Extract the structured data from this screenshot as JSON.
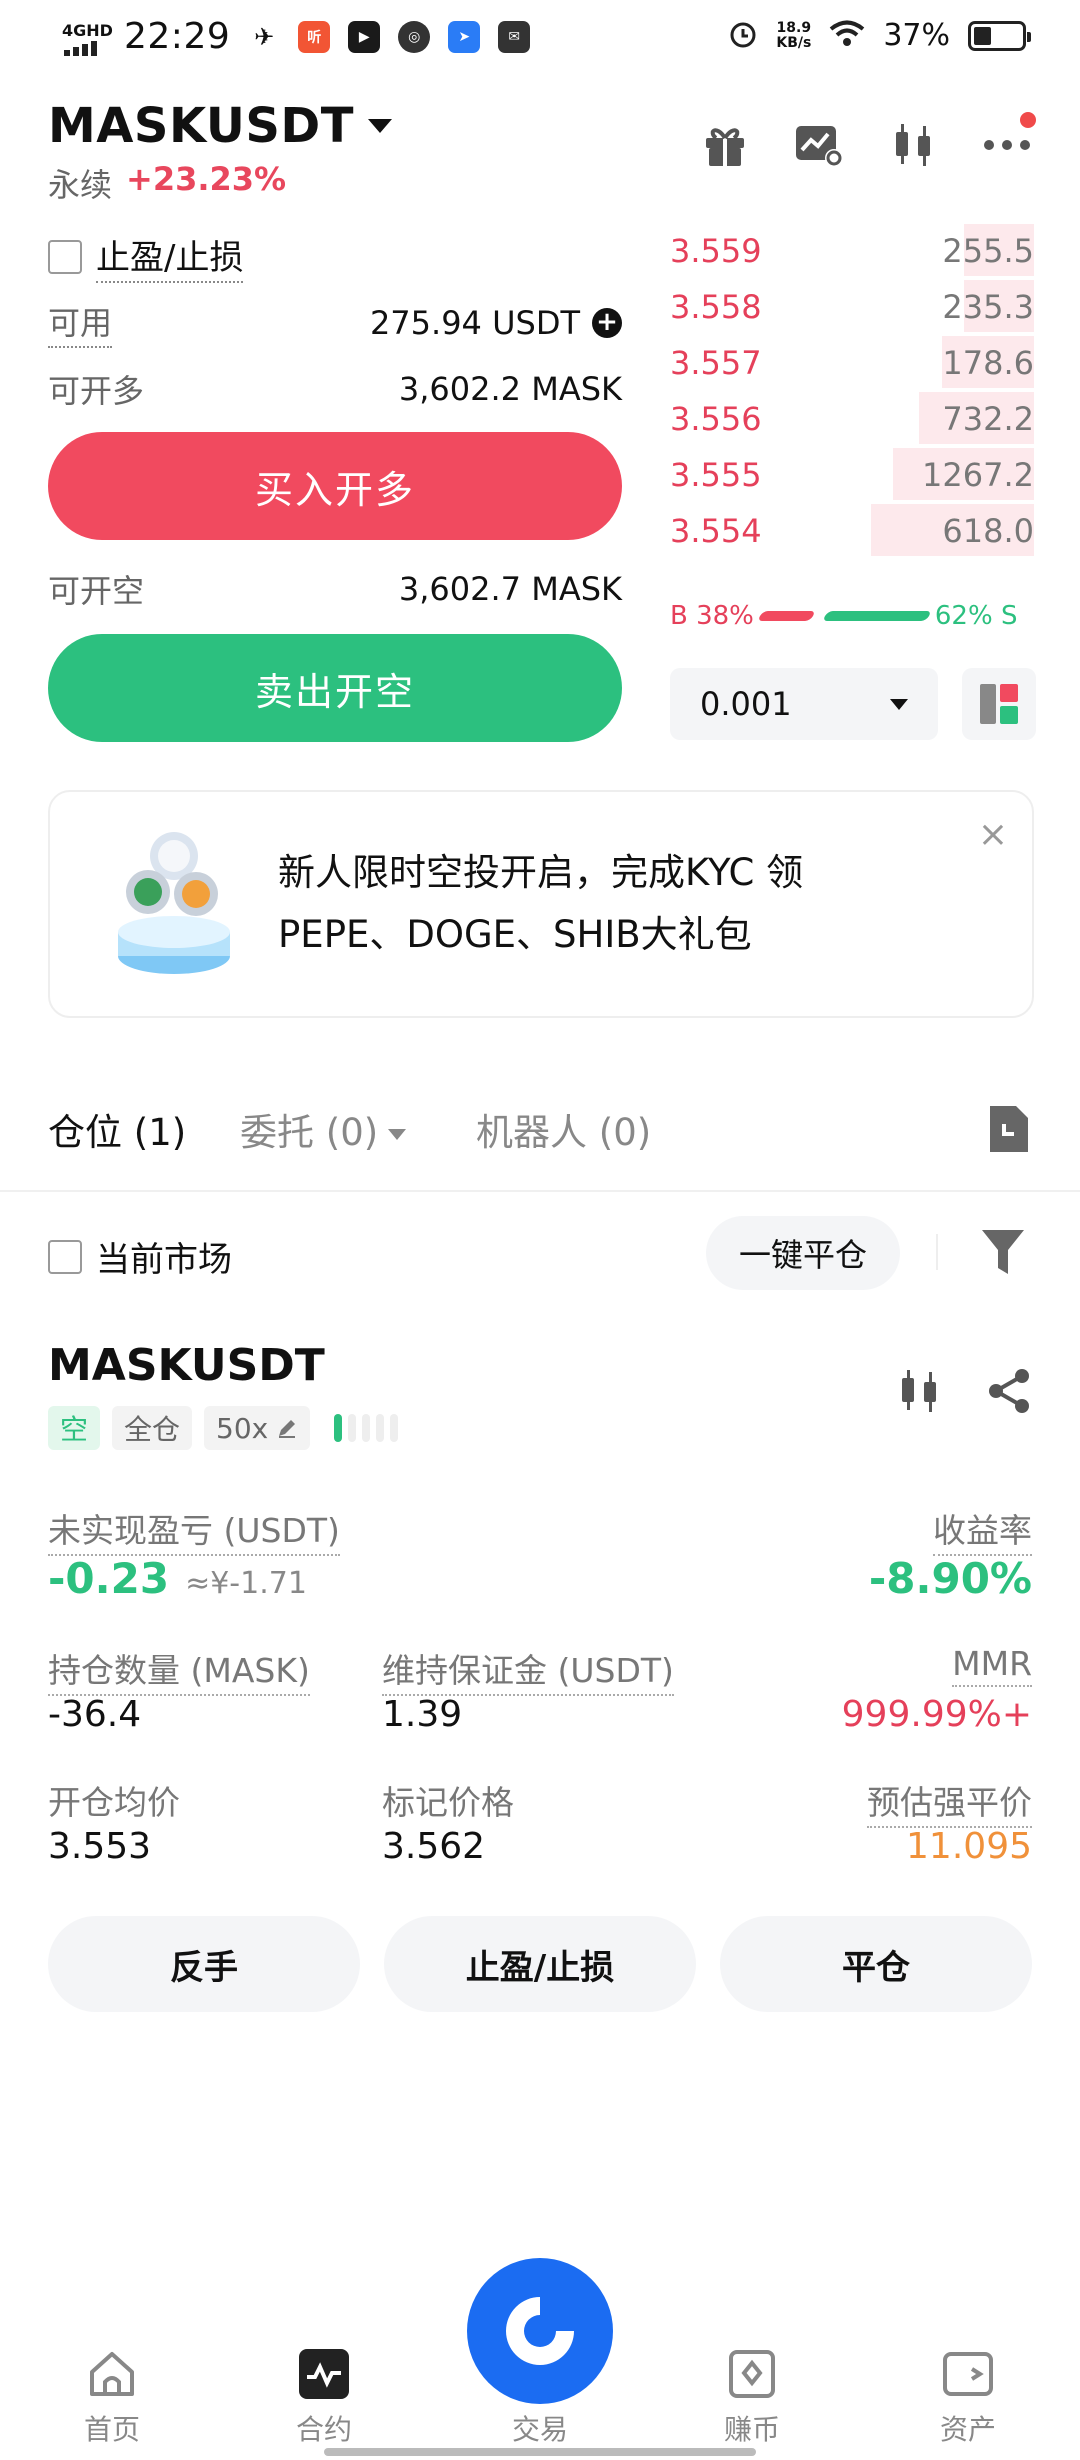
{
  "status_bar": {
    "network": "4GHD",
    "time": "22:29",
    "speed_value": "18.9",
    "speed_unit": "KB/s",
    "battery_pct": "37%"
  },
  "header": {
    "pair": "MASKUSDT",
    "contract_type": "永续",
    "change": "+23.23%"
  },
  "order_form": {
    "tpsl_label": "止盈/止损",
    "available_label": "可用",
    "available_value": "275.94 USDT",
    "can_long_label": "可开多",
    "can_long_value": "3,602.2 MASK",
    "buy_button": "买入开多",
    "can_short_label": "可开空",
    "can_short_value": "3,602.7 MASK",
    "sell_button": "卖出开空"
  },
  "order_book": {
    "asks": [
      {
        "price": "3.559",
        "qty": "255.5",
        "depth": 0.19
      },
      {
        "price": "3.558",
        "qty": "235.3",
        "depth": 0.19
      },
      {
        "price": "3.557",
        "qty": "178.6",
        "depth": 0.25
      },
      {
        "price": "3.556",
        "qty": "732.2",
        "depth": 0.31
      },
      {
        "price": "3.555",
        "qty": "1267.2",
        "depth": 0.38
      },
      {
        "price": "3.554",
        "qty": "618.0",
        "depth": 0.44
      }
    ],
    "buy_ratio_label": "B 38%",
    "sell_ratio_label": "62% S",
    "buy_ratio": 0.38,
    "precision": "0.001"
  },
  "banner": {
    "line1": "新人限时空投开启，完成KYC 领",
    "line2": "PEPE、DOGE、SHIB大礼包",
    "close": "×"
  },
  "tabs": {
    "positions": "仓位 (1)",
    "orders": "委托 (0)",
    "bots": "机器人 (0)"
  },
  "filters": {
    "current_market": "当前市场",
    "close_all": "一键平仓"
  },
  "position": {
    "symbol": "MASKUSDT",
    "side_tag": "空",
    "margin_tag": "全仓",
    "leverage_tag": "50x",
    "unrealized_label": "未实现盈亏 (USDT)",
    "unrealized_value": "-0.23",
    "unrealized_cny": "≈¥-1.71",
    "roe_label": "收益率",
    "roe_value": "-8.90%",
    "size_label": "持仓数量 (MASK)",
    "size_value": "-36.4",
    "margin_label": "维持保证金 (USDT)",
    "margin_value": "1.39",
    "mmr_label": "MMR",
    "mmr_value": "999.99%+",
    "entry_label": "开仓均价",
    "entry_value": "3.553",
    "mark_label": "标记价格",
    "mark_value": "3.562",
    "liq_label": "预估强平价",
    "liq_value": "11.095"
  },
  "actions": {
    "reverse": "反手",
    "tpsl": "止盈/止损",
    "close": "平仓"
  },
  "bottom_nav": {
    "home": "首页",
    "futures": "合约",
    "trade": "交易",
    "earn": "赚币",
    "assets": "资产"
  },
  "colors": {
    "buy": "#f14a5f",
    "sell": "#2cc07f",
    "accent": "#1b6cf2",
    "liq": "#f0913a"
  }
}
